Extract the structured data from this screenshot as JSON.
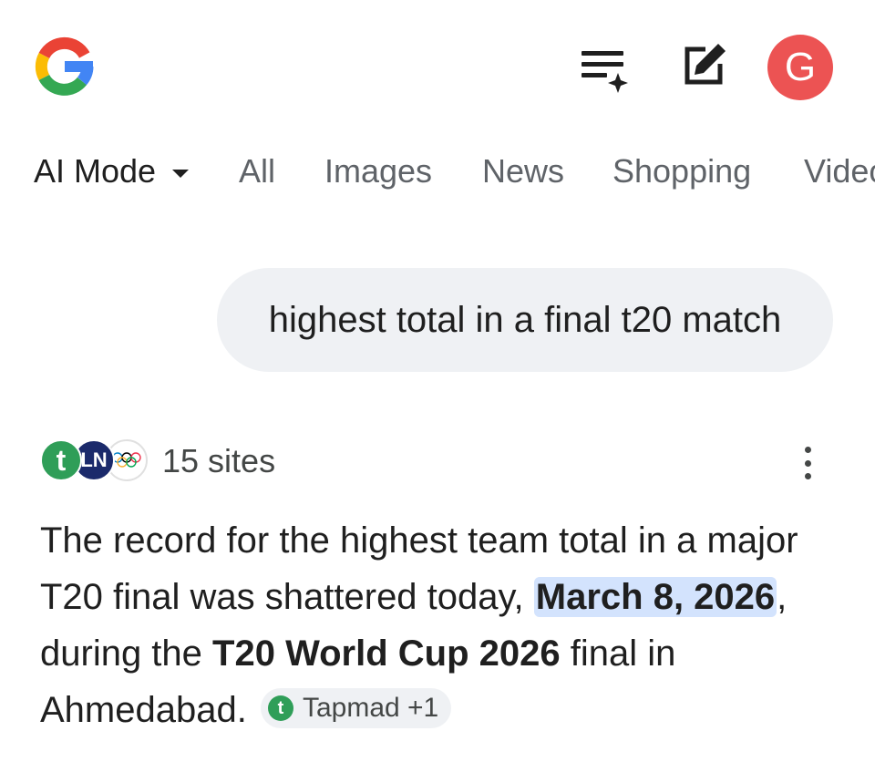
{
  "header": {
    "logo_icon": "google-g-logo",
    "history_icon": "ai-history-icon",
    "new_chat_icon": "edit-icon",
    "avatar_letter": "G",
    "avatar_color": "#ec5353"
  },
  "tabs": [
    {
      "label": "AI Mode",
      "active": true
    },
    {
      "label": "All"
    },
    {
      "label": "Images"
    },
    {
      "label": "News"
    },
    {
      "label": "Shopping"
    },
    {
      "label": "Videos"
    }
  ],
  "query": "highest total in a final t20 match",
  "sources": {
    "icons": [
      {
        "letter": "t",
        "color": "#2f9e58"
      },
      {
        "letter": "LN",
        "color": "#1b2a6b"
      },
      {
        "icon": "olympic-rings-icon"
      }
    ],
    "count_label": "15 sites"
  },
  "answer": {
    "part1": "The record for the highest team total in a major T20 final was shattered today, ",
    "date": "March 8, 2026",
    "part2": ", during the ",
    "event": "T20 World Cup 2026",
    "part3": " final in Ahmedabad.",
    "citation": {
      "letter": "t",
      "label": "Tapmad +1"
    }
  },
  "colors": {
    "accent_highlight": "#d3e3fd",
    "chip_bg": "#eff1f4"
  }
}
